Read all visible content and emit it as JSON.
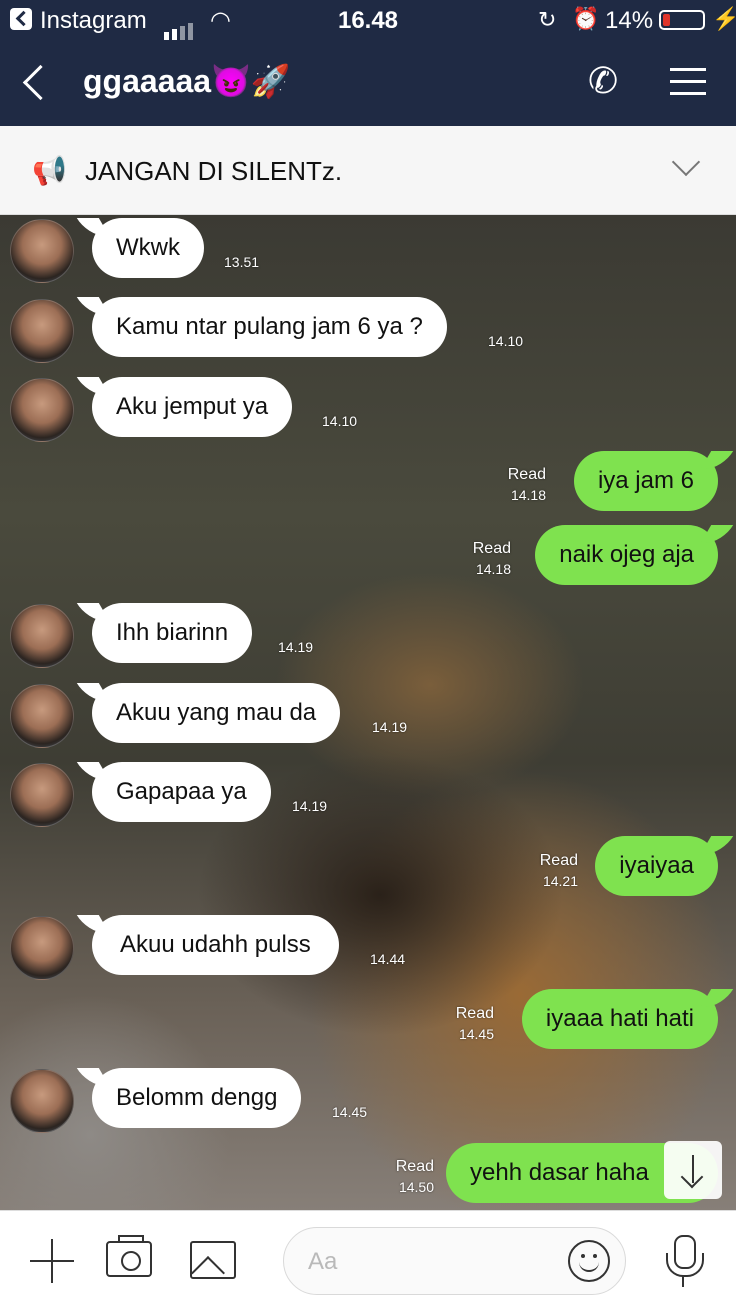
{
  "status_bar": {
    "app": "Instagram",
    "time": "16.48",
    "battery": "14%",
    "battery_level": 0.14
  },
  "header": {
    "title": "ggaaaaa😈🚀",
    "back_icon": "chevron-left-icon",
    "call_icon": "phone-icon",
    "menu_icon": "hamburger-menu-icon",
    "background": "#1f2a44"
  },
  "announcement": {
    "icon": "megaphone-icon",
    "text": "JANGAN DI SILENTz."
  },
  "messages": [
    {
      "dir": "in",
      "text": "Wkwk",
      "time": "13.51"
    },
    {
      "dir": "in",
      "text": "Kamu ntar pulang jam 6 ya ?",
      "time": "14.10"
    },
    {
      "dir": "in",
      "text": "Aku jemput ya",
      "time": "14.10"
    },
    {
      "dir": "out",
      "text": "iya jam 6",
      "time": "14.18",
      "status": "Read"
    },
    {
      "dir": "out",
      "text": "naik ojeg aja",
      "time": "14.18",
      "status": "Read"
    },
    {
      "dir": "in",
      "text": "Ihh biarinn",
      "time": "14.19"
    },
    {
      "dir": "in",
      "text": "Akuu yang mau da",
      "time": "14.19"
    },
    {
      "dir": "in",
      "text": "Gapapaa ya",
      "time": "14.19"
    },
    {
      "dir": "out",
      "text": "iyaiyaa",
      "time": "14.21",
      "status": "Read"
    },
    {
      "dir": "in",
      "text": "Akuu udahh pulss",
      "time": "14.44"
    },
    {
      "dir": "out",
      "text": "iyaaa hati hati",
      "time": "14.45",
      "status": "Read"
    },
    {
      "dir": "in",
      "text": "Belomm dengg",
      "time": "14.45"
    },
    {
      "dir": "out",
      "text": "yehh dasar haha",
      "time": "14.50",
      "status": "Read"
    }
  ],
  "composer": {
    "placeholder": "Aa",
    "plus_icon": "plus-icon",
    "camera_icon": "camera-icon",
    "image_icon": "image-icon",
    "emoji_icon": "emoji-icon",
    "mic_icon": "microphone-icon"
  },
  "colors": {
    "outgoing_bubble": "#7fe24f",
    "incoming_bubble": "#ffffff"
  }
}
